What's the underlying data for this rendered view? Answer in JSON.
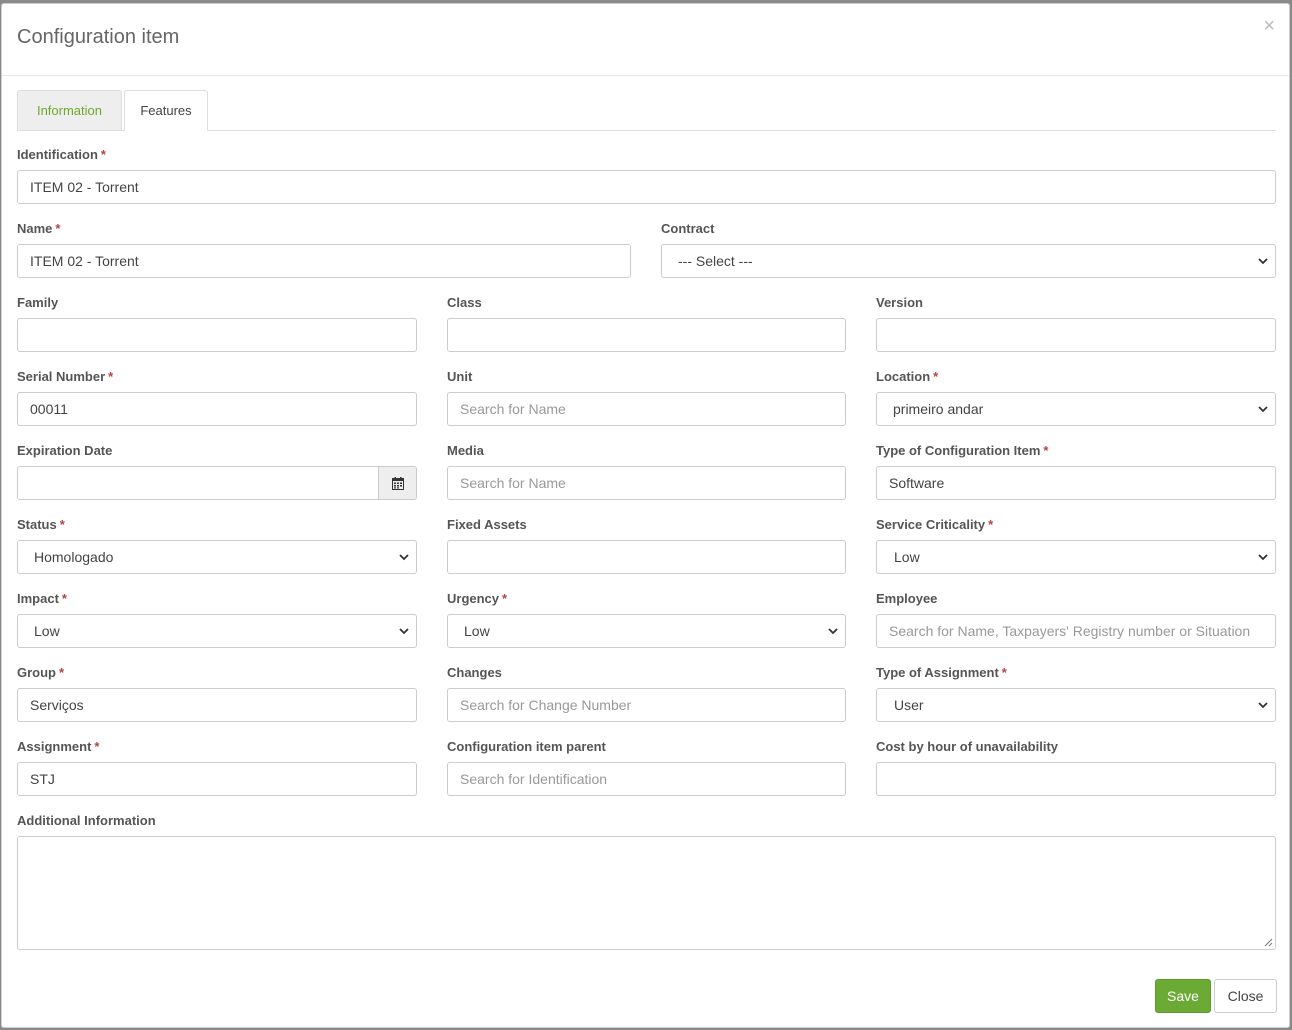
{
  "modal": {
    "title": "Configuration item",
    "close_glyph": "×"
  },
  "tabs": [
    {
      "label": "Information",
      "active": true
    },
    {
      "label": "Features",
      "active": false
    }
  ],
  "fields": {
    "identification": {
      "label": "Identification",
      "required": true,
      "value": "ITEM 02 - Torrent"
    },
    "name": {
      "label": "Name",
      "required": true,
      "value": "ITEM 02 - Torrent"
    },
    "contract": {
      "label": "Contract",
      "required": false,
      "value": "--- Select ---"
    },
    "family": {
      "label": "Family",
      "required": false,
      "value": ""
    },
    "class": {
      "label": "Class",
      "required": false,
      "value": ""
    },
    "version": {
      "label": "Version",
      "required": false,
      "value": ""
    },
    "serial_number": {
      "label": "Serial Number",
      "required": true,
      "value": "00011"
    },
    "unit": {
      "label": "Unit",
      "required": false,
      "value": "",
      "placeholder": "Search for Name"
    },
    "location": {
      "label": "Location",
      "required": true,
      "value": "primeiro andar"
    },
    "expiration_date": {
      "label": "Expiration Date",
      "required": false,
      "value": ""
    },
    "media": {
      "label": "Media",
      "required": false,
      "value": "",
      "placeholder": "Search for Name"
    },
    "type_ci": {
      "label": "Type of Configuration Item",
      "required": true,
      "value": "Software"
    },
    "status": {
      "label": "Status",
      "required": true,
      "value": "Homologado"
    },
    "fixed_assets": {
      "label": "Fixed Assets",
      "required": false,
      "value": ""
    },
    "service_criticality": {
      "label": "Service Criticality",
      "required": true,
      "value": "Low"
    },
    "impact": {
      "label": "Impact",
      "required": true,
      "value": "Low"
    },
    "urgency": {
      "label": "Urgency",
      "required": true,
      "value": "Low"
    },
    "employee": {
      "label": "Employee",
      "required": false,
      "value": "",
      "placeholder": "Search for Name, Taxpayers' Registry number or Situation"
    },
    "group": {
      "label": "Group",
      "required": true,
      "value": "Serviços"
    },
    "changes": {
      "label": "Changes",
      "required": false,
      "value": "",
      "placeholder": "Search for Change Number"
    },
    "type_assignment": {
      "label": "Type of Assignment",
      "required": true,
      "value": "User"
    },
    "assignment": {
      "label": "Assignment",
      "required": true,
      "value": "STJ"
    },
    "ci_parent": {
      "label": "Configuration item parent",
      "required": false,
      "value": "",
      "placeholder": "Search for Identification"
    },
    "cost_hour": {
      "label": "Cost by hour of unavailability",
      "required": false,
      "value": ""
    },
    "additional_info": {
      "label": "Additional Information",
      "required": false,
      "value": ""
    }
  },
  "required_marker": "*",
  "buttons": {
    "save": "Save",
    "close": "Close"
  },
  "colors": {
    "accent": "#6aaa35",
    "required": "#b5443f",
    "tab_active_text": "#6aaa2b"
  },
  "icons": {
    "calendar": "calendar-icon",
    "chevron": "chevron-down-icon",
    "close": "close-icon"
  }
}
